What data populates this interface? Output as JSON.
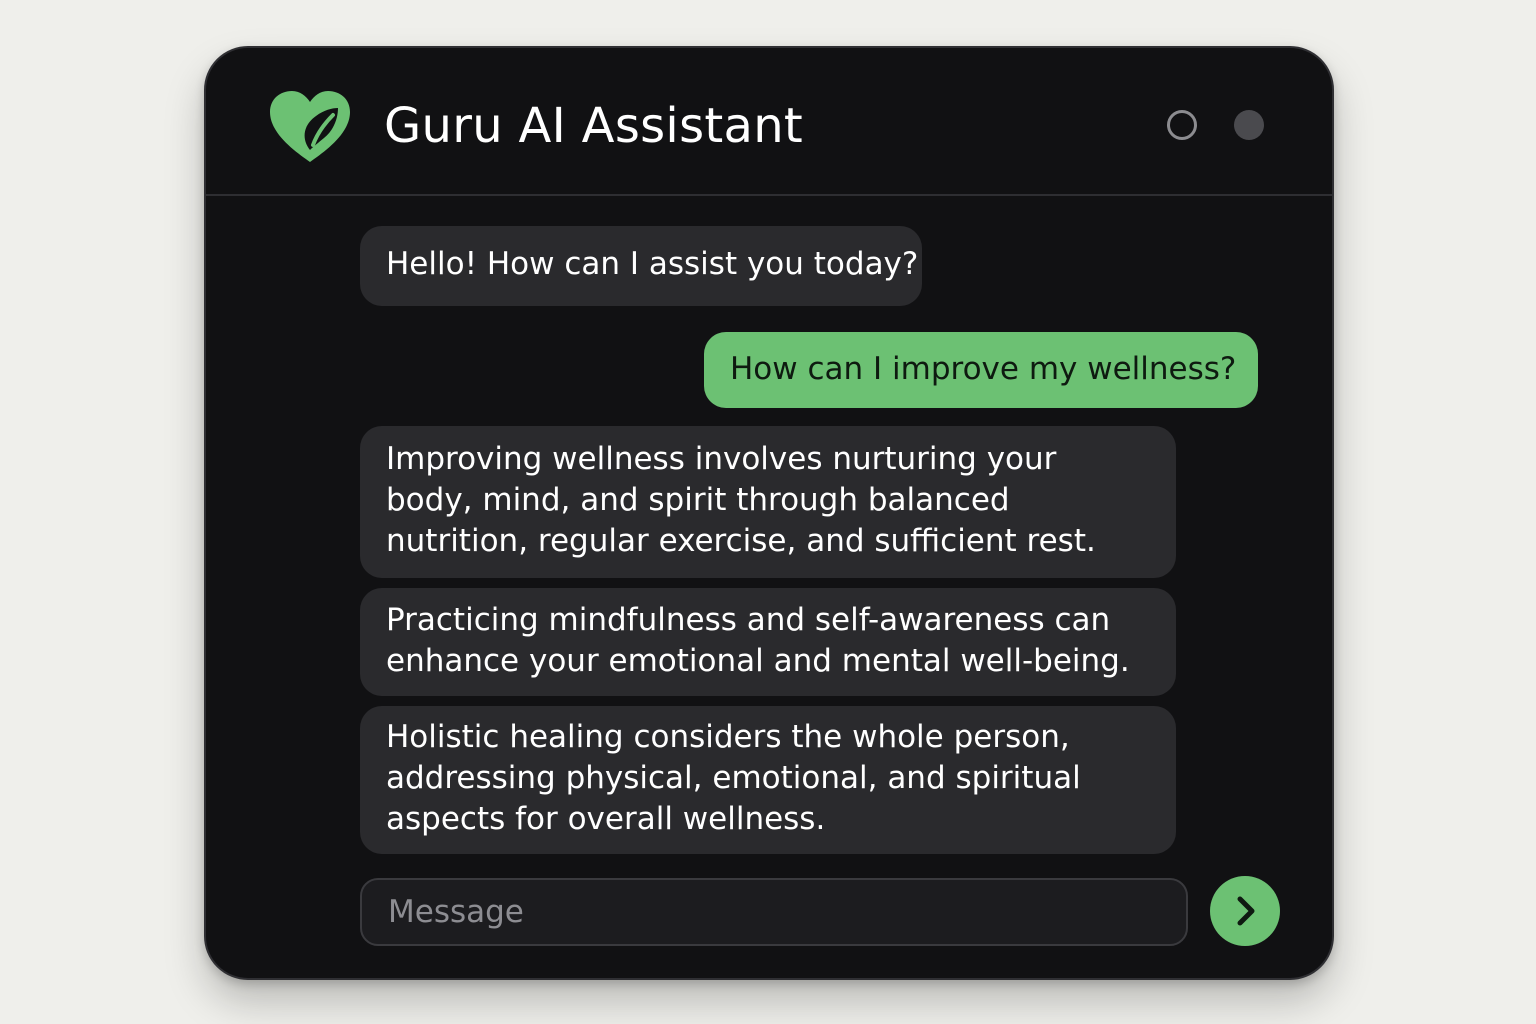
{
  "app": {
    "title": "Guru AI Assistant",
    "logo_icon": "heart-leaf-icon",
    "accent_color": "#6cc173"
  },
  "window_controls": [
    {
      "name": "outline-circle-control"
    },
    {
      "name": "filled-circle-control"
    }
  ],
  "messages": [
    {
      "role": "assistant",
      "text": "Hello! How can I assist you today?"
    },
    {
      "role": "user",
      "text": "How can I improve my wellness?"
    },
    {
      "role": "assistant",
      "text": "Improving wellness involves nurturing your body, mind, and spirit through balanced nutrition, regular exercise, and sufficient rest."
    },
    {
      "role": "assistant",
      "text": "Practicing mindfulness and self-awareness can enhance your emotional and mental well-being."
    },
    {
      "role": "assistant",
      "text": "Holistic healing considers the whole person, addressing physical, emotional, and spiritual aspects for overall wellness."
    }
  ],
  "composer": {
    "placeholder": "Message",
    "value": "",
    "send_icon": "chevron-right-icon"
  }
}
